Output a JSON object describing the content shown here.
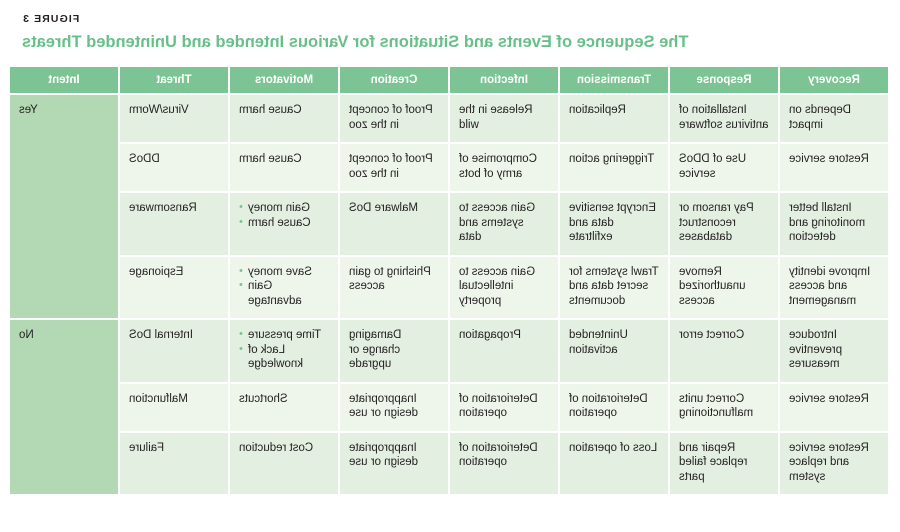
{
  "figure": {
    "label": "FIGURE 3",
    "title": "The Sequence of Events and Situations for Various Intended and Unintended Threats"
  },
  "colors": {
    "header_bg": "#7cc493",
    "header_text": "#ffffff",
    "title_text": "#67bf8a",
    "intent_bg": "#b3d8b4",
    "row_band_a": "#e3efe1",
    "row_band_b": "#eef6ec",
    "bullet": "#7cc493",
    "body_text": "#231f20"
  },
  "table": {
    "columns": [
      "Recovery",
      "Response",
      "Transmission",
      "Infection",
      "Creation",
      "Motivators",
      "Threat",
      "Intent"
    ],
    "intent_groups": [
      {
        "label": "Yes",
        "rows": 4
      },
      {
        "label": "No",
        "rows": 3
      }
    ],
    "rows": [
      {
        "recovery": "Depends on impact",
        "response": "Installation of antivirus software",
        "transmission": "Replication",
        "infection": "Release in the wild",
        "creation": "Proof of concept in the zoo",
        "motivators": [
          "Cause harm"
        ],
        "motivators_bulleted": false,
        "threat": "Virus/Worm"
      },
      {
        "recovery": "Restore service",
        "response": "Use of DDoS service",
        "transmission": "Triggering action",
        "infection": "Compromise of army of bots",
        "creation": "Proof of concept in the zoo",
        "motivators": [
          "Cause harm"
        ],
        "motivators_bulleted": false,
        "threat": "DDoS"
      },
      {
        "recovery": "Install better monitoring and detection",
        "response": "Pay ransom or reconstruct databases",
        "transmission": "Encrypt sensitive data and exfiltrate",
        "infection": "Gain access to systems and data",
        "creation": "Malware DoS",
        "motivators": [
          "Gain money",
          "Cause harm"
        ],
        "motivators_bulleted": true,
        "threat": "Ransomware"
      },
      {
        "recovery": "Improve identity and access management",
        "response": "Remove unauthorized access",
        "transmission": "Trawl systems for secret data and documents",
        "infection": "Gain access to intellectual property",
        "creation": "Phishing to gain access",
        "motivators": [
          "Save money",
          "Gain advantage"
        ],
        "motivators_bulleted": true,
        "threat": "Espionage"
      },
      {
        "recovery": "Introduce preventive measures",
        "response": "Correct error",
        "transmission": "Unintended activation",
        "infection": "Propagation",
        "creation": "Damaging change or upgrade",
        "motivators": [
          "Time pressure",
          "Lack of knowledge"
        ],
        "motivators_bulleted": true,
        "threat": "Internal DoS"
      },
      {
        "recovery": "Restore service",
        "response": "Correct units malfunctioning",
        "transmission": "Deterioration of operation",
        "infection": "Deterioration of operation",
        "creation": "Inappropriate design or use",
        "motivators": [
          "Shortcuts"
        ],
        "motivators_bulleted": false,
        "threat": "Malfunction"
      },
      {
        "recovery": "Restore service and replace system",
        "response": "Repair and replace failed parts",
        "transmission": "Loss of operation",
        "infection": "Deterioration of operation",
        "creation": "Inappropriate design or use",
        "motivators": [
          "Cost reduction"
        ],
        "motivators_bulleted": false,
        "threat": "Failure"
      }
    ]
  }
}
